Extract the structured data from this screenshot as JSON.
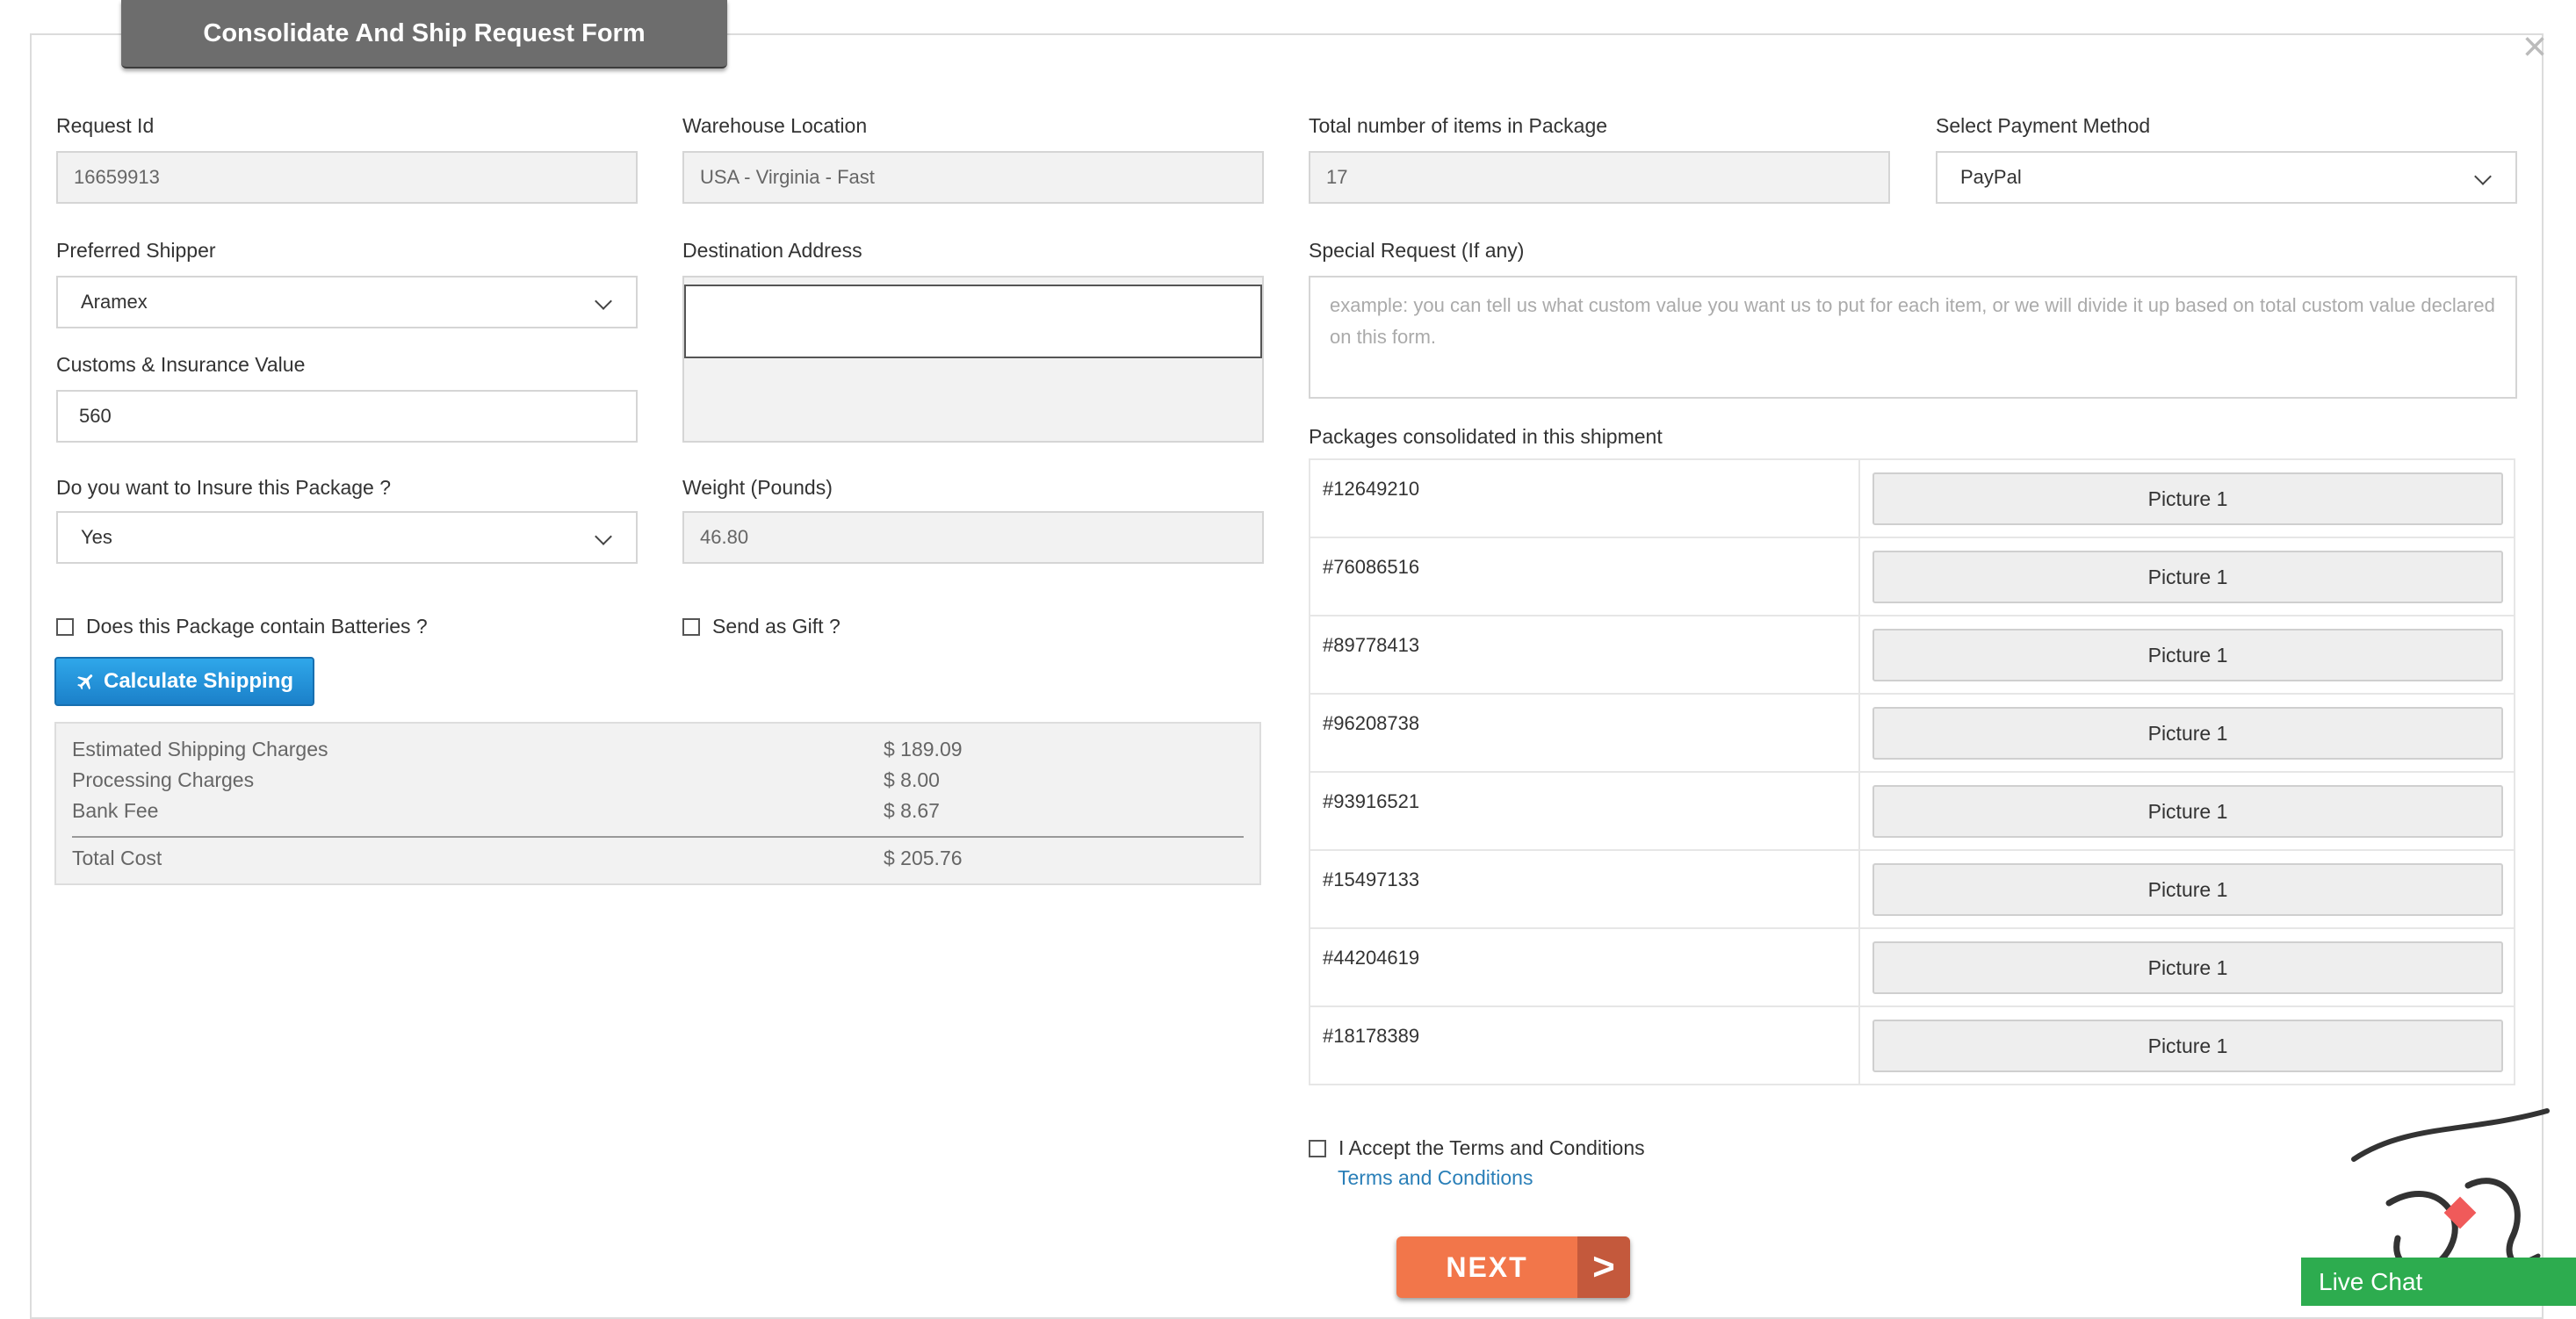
{
  "form": {
    "title": "Consolidate And Ship Request Form",
    "close_glyph": "×",
    "request_id": {
      "label": "Request Id",
      "value": "16659913"
    },
    "warehouse": {
      "label": "Warehouse Location",
      "value": "USA - Virginia - Fast"
    },
    "total_items": {
      "label": "Total number of items in Package",
      "value": "17"
    },
    "payment": {
      "label": "Select Payment Method",
      "value": "PayPal"
    },
    "shipper": {
      "label": "Preferred Shipper",
      "value": "Aramex"
    },
    "destination": {
      "label": "Destination Address",
      "value": ""
    },
    "special_request": {
      "label": "Special Request (If any)",
      "placeholder": "example: you can tell us what custom value you want us to put for each item, or we will divide it up based on total custom value declared on this form."
    },
    "customs": {
      "label": "Customs & Insurance Value",
      "value": "560"
    },
    "insure": {
      "label": "Do you want to Insure this Package ?",
      "value": "Yes"
    },
    "weight": {
      "label": "Weight (Pounds)",
      "value": "46.80"
    },
    "batteries": {
      "label": "Does this Package contain Batteries ?",
      "checked": false
    },
    "gift": {
      "label": "Send as Gift ?",
      "checked": false
    },
    "calculate_button": "Calculate Shipping",
    "costs": [
      {
        "label": "Estimated Shipping Charges",
        "value": "$ 189.09"
      },
      {
        "label": "Processing Charges",
        "value": "$ 8.00"
      },
      {
        "label": "Bank Fee",
        "value": "$ 8.67"
      }
    ],
    "total": {
      "label": "Total Cost",
      "value": "$ 205.76"
    },
    "packages_label": "Packages consolidated in this shipment",
    "packages": [
      {
        "id": "#12649210",
        "button": "Picture 1"
      },
      {
        "id": "#76086516",
        "button": "Picture 1"
      },
      {
        "id": "#89778413",
        "button": "Picture 1"
      },
      {
        "id": "#96208738",
        "button": "Picture 1"
      },
      {
        "id": "#93916521",
        "button": "Picture 1"
      },
      {
        "id": "#15497133",
        "button": "Picture 1"
      },
      {
        "id": "#44204619",
        "button": "Picture 1"
      },
      {
        "id": "#18178389",
        "button": "Picture 1"
      }
    ],
    "terms_checkbox": "I Accept the Terms and Conditions",
    "terms_link": "Terms and Conditions",
    "next_button": "NEXT",
    "next_arrow": ">"
  },
  "live_chat": "Live Chat",
  "colors": {
    "accent_blue": "#1b80c9",
    "next_orange": "#f2764a",
    "chat_green": "#2dac4f"
  }
}
